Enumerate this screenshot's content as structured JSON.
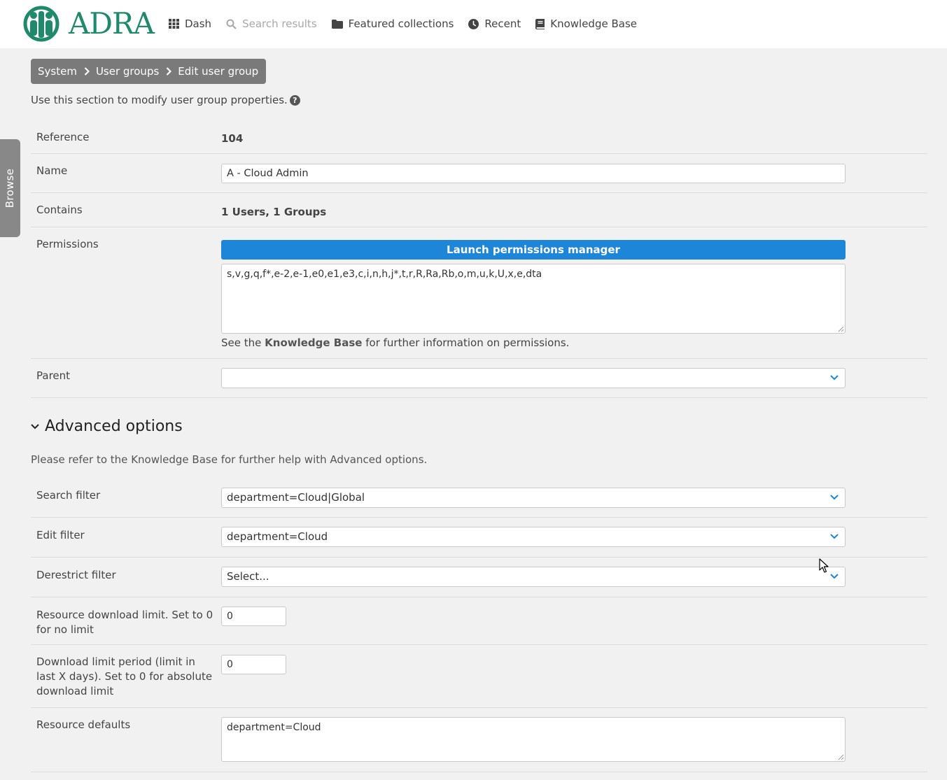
{
  "header": {
    "logo_text": "ADRA",
    "nav": [
      {
        "label": "Dash",
        "icon": "grid-icon"
      },
      {
        "label": "Search results",
        "icon": "search-icon",
        "disabled": true
      },
      {
        "label": "Featured collections",
        "icon": "folder-icon"
      },
      {
        "label": "Recent",
        "icon": "clock-icon"
      },
      {
        "label": "Knowledge Base",
        "icon": "book-icon"
      }
    ]
  },
  "browse_tab": {
    "label": "Browse"
  },
  "breadcrumb": [
    "System",
    "User groups",
    "Edit user group"
  ],
  "intro": "Use this section to modify user group properties.",
  "form": {
    "reference": {
      "label": "Reference",
      "value": "104"
    },
    "name": {
      "label": "Name",
      "value": "A - Cloud Admin"
    },
    "contains": {
      "label": "Contains",
      "value": "1 Users, 1 Groups"
    },
    "permissions": {
      "label": "Permissions",
      "button": "Launch permissions manager",
      "value": "s,v,g,q,f*,e-2,e-1,e0,e1,e3,c,i,n,h,j*,t,r,R,Ra,Rb,o,m,u,k,U,x,e,dta",
      "note_prefix": "See the",
      "note_link": "Knowledge Base",
      "note_suffix": "for further information on permissions."
    },
    "parent": {
      "label": "Parent",
      "value": ""
    }
  },
  "advanced": {
    "heading": "Advanced options",
    "note_prefix": "Please refer to the",
    "note_link": "Knowledge Base",
    "note_suffix": "for further help with Advanced options.",
    "search_filter": {
      "label": "Search filter",
      "value": "department=Cloud|Global"
    },
    "edit_filter": {
      "label": "Edit filter",
      "value": "department=Cloud"
    },
    "derestrict_filter": {
      "label": "Derestrict filter",
      "value": "Select..."
    },
    "download_limit": {
      "label": "Resource download limit. Set to 0 for no limit",
      "value": "0"
    },
    "download_period": {
      "label": "Download limit period (limit in last X days). Set to 0 for absolute download limit",
      "value": "0"
    },
    "resource_defaults": {
      "label": "Resource defaults",
      "value": "department=Cloud"
    }
  },
  "colors": {
    "brand": "#1f8a6a",
    "primary_button": "#1d86d8",
    "breadcrumb_bg": "#7a7a7a"
  }
}
